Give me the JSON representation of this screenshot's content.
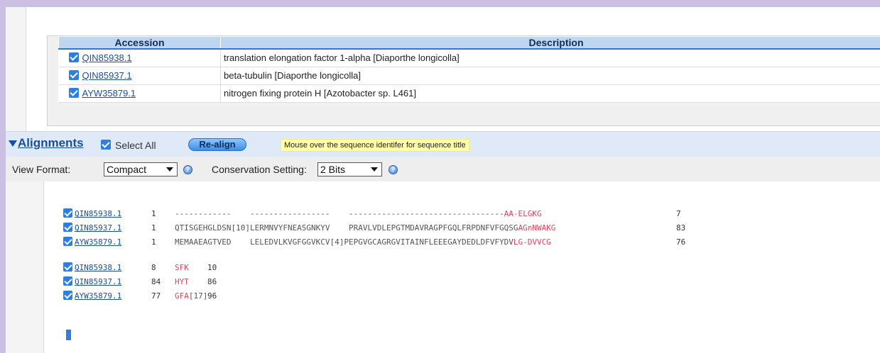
{
  "table": {
    "headers": {
      "accession": "Accession",
      "description": "Description"
    },
    "rows": [
      {
        "accession": "QIN85938.1",
        "description": "translation elongation factor 1-alpha [Diaporthe longicolla]"
      },
      {
        "accession": "QIN85937.1",
        "description": "beta-tubulin [Diaporthe longicolla]"
      },
      {
        "accession": "AYW35879.1",
        "description": "nitrogen fixing protein H [Azotobacter sp. L461]"
      }
    ]
  },
  "alignments": {
    "title": "Alignments",
    "select_all": "Select All",
    "realign": "Re-align",
    "hint": "Mouse over the sequence identifer for sequence title"
  },
  "view": {
    "format_label": "View Format:",
    "format_value": "Compact",
    "conservation_label": "Conservation Setting:",
    "conservation_value": "2 Bits",
    "help_icon": "?"
  },
  "blocks": [
    {
      "rows": [
        {
          "id": "QIN85938.1",
          "start": "1",
          "seq": "------------    -----------------    ---------------------------------",
          "red": "AA-ELGKG",
          "end": "7"
        },
        {
          "id": "QIN85937.1",
          "start": "1",
          "seq": "QTISGEHGLDSN[10]LERMNVYFNEASGNKYV    PRAVLVDLEPGTMDAVRAGPFGQLFRPDNFVFGQSG",
          "red": "AGnNWAKG",
          "end": "83"
        },
        {
          "id": "AYW35879.1",
          "start": "1",
          "seq": "MEMAAEAGTVED    LELEDVLKVGFGGVKCV[4]PEPGVGCAGRGVITAINFLEEEGAYDEDLDFVFYDV",
          "red": "LG-DVVCG",
          "end": "76"
        }
      ]
    },
    {
      "rows": [
        {
          "id": "QIN85938.1",
          "start": "8",
          "red": "SFK",
          "seq": "",
          "end": "10"
        },
        {
          "id": "QIN85937.1",
          "start": "84",
          "red": "HYT",
          "seq": "",
          "end": "86"
        },
        {
          "id": "AYW35879.1",
          "start": "77",
          "red": "GFA",
          "seq": "[17]",
          "end": "96"
        }
      ]
    }
  ]
}
